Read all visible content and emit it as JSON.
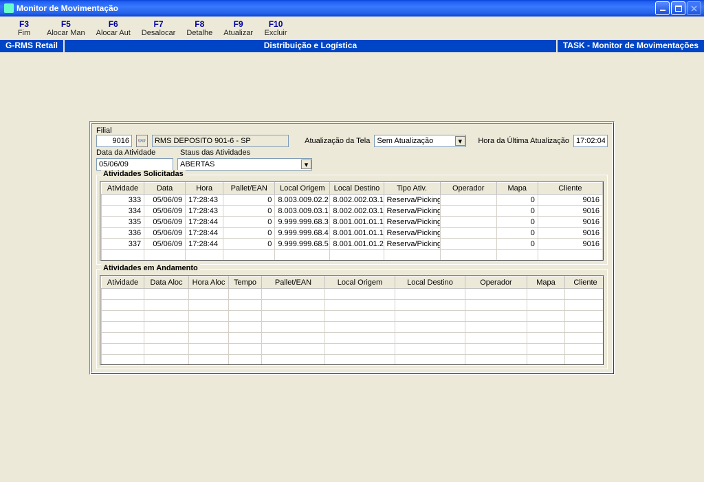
{
  "window": {
    "title": "Monitor de Movimentação"
  },
  "toolbar": [
    {
      "key": "F3",
      "label": "Fim"
    },
    {
      "key": "F5",
      "label": "Alocar Man"
    },
    {
      "key": "F6",
      "label": "Alocar Aut"
    },
    {
      "key": "F7",
      "label": "Desalocar"
    },
    {
      "key": "F8",
      "label": "Detalhe"
    },
    {
      "key": "F9",
      "label": "Atualizar"
    },
    {
      "key": "F10",
      "label": "Excluir"
    }
  ],
  "ribbon": {
    "left": "G-RMS Retail",
    "center": "Distribuição e Logística",
    "right": "TASK - Monitor de Movimentações"
  },
  "labels": {
    "filial": "Filial",
    "atualizacao_tela": "Atualização da Tela",
    "hora_ultima": "Hora da Última Atualização",
    "data_atividade": "Data da Atividade",
    "status_atividades": "Staus das Atividades",
    "grupo_solicitadas": "Atividades Solicitadas",
    "grupo_andamento": "Atividades em Andamento"
  },
  "form": {
    "filial_code": "9016",
    "filial_desc": "RMS DEPOSITO 901-6 - SP",
    "atualizacao_sel": "Sem Atualização",
    "hora_ultima": "17:02:04",
    "data_atividade": "05/06/09",
    "status_sel": "ABERTAS"
  },
  "solicitadas": {
    "cols": [
      "Atividade",
      "Data",
      "Hora",
      "Pallet/EAN",
      "Local Origem",
      "Local Destino",
      "Tipo Ativ.",
      "Operador",
      "Mapa",
      "Cliente"
    ],
    "rows": [
      {
        "atividade": "333",
        "data": "05/06/09",
        "hora": "17:28:43",
        "pallet": "0",
        "origem": "8.003.009.02.2",
        "destino": "8.002.002.03.1",
        "tipo": "Reserva/Picking",
        "operador": "",
        "mapa": "0",
        "cliente": "9016"
      },
      {
        "atividade": "334",
        "data": "05/06/09",
        "hora": "17:28:43",
        "pallet": "0",
        "origem": "8.003.009.03.1",
        "destino": "8.002.002.03.1",
        "tipo": "Reserva/Picking",
        "operador": "",
        "mapa": "0",
        "cliente": "9016"
      },
      {
        "atividade": "335",
        "data": "05/06/09",
        "hora": "17:28:44",
        "pallet": "0",
        "origem": "9.999.999.68.3",
        "destino": "8.001.001.01.1",
        "tipo": "Reserva/Picking",
        "operador": "",
        "mapa": "0",
        "cliente": "9016"
      },
      {
        "atividade": "336",
        "data": "05/06/09",
        "hora": "17:28:44",
        "pallet": "0",
        "origem": "9.999.999.68.4",
        "destino": "8.001.001.01.1",
        "tipo": "Reserva/Picking",
        "operador": "",
        "mapa": "0",
        "cliente": "9016"
      },
      {
        "atividade": "337",
        "data": "05/06/09",
        "hora": "17:28:44",
        "pallet": "0",
        "origem": "9.999.999.68.5",
        "destino": "8.001.001.01.2",
        "tipo": "Reserva/Picking",
        "operador": "",
        "mapa": "0",
        "cliente": "9016"
      }
    ]
  },
  "andamento": {
    "cols": [
      "Atividade",
      "Data Aloc",
      "Hora Aloc",
      "Tempo",
      "Pallet/EAN",
      "Local Origem",
      "Local Destino",
      "Operador",
      "Mapa",
      "Cliente"
    ]
  }
}
